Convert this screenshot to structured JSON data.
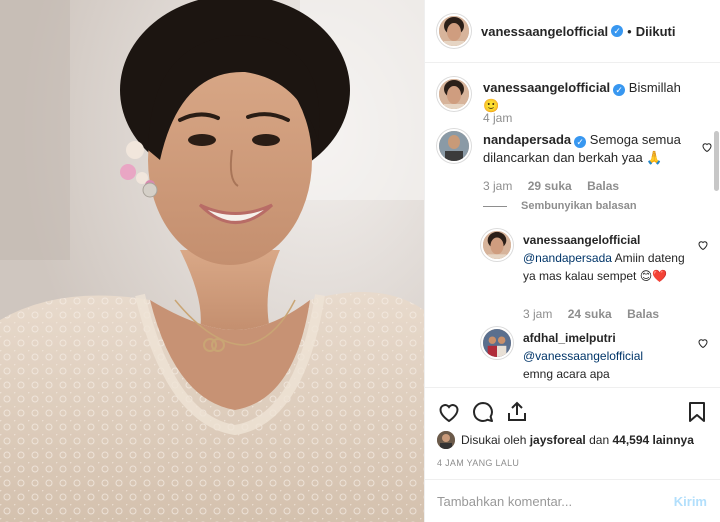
{
  "header": {
    "username": "vanessaangelofficial",
    "separator": "•",
    "follow_label": "Diikuti"
  },
  "caption": {
    "username": "vanessaangelofficial",
    "text": "Bismillah 🙂",
    "time": "4 jam"
  },
  "comments": [
    {
      "username": "nandapersada",
      "text": "Semoga semua dilancarkan dan berkah yaa 🙏",
      "time": "3 jam",
      "likes": "29 suka",
      "reply_label": "Balas"
    }
  ],
  "hide_replies_label": "Sembunyikan balasan",
  "replies": [
    {
      "username": "vanessaangelofficial",
      "mention": "@nandapersada",
      "text": "Amiin dateng ya mas kalau sempet 😊❤️",
      "time": "3 jam",
      "likes": "24 suka",
      "reply_label": "Balas"
    },
    {
      "username": "afdhal_imelputri",
      "mention": "@vanessaangelofficial",
      "text": "emng acara apa"
    }
  ],
  "likes": {
    "prefix": "Disukai oleh",
    "user": "jaysforeal",
    "middle": "dan",
    "count": "44,594 lainnya"
  },
  "timestamp": "4 JAM YANG LALU",
  "add_comment": {
    "placeholder": "Tambahkan komentar...",
    "send_label": "Kirim"
  },
  "colors": {
    "verified": "#3897f0",
    "send_disabled": "#b2dffc",
    "meta_text": "#8e8e8e"
  }
}
